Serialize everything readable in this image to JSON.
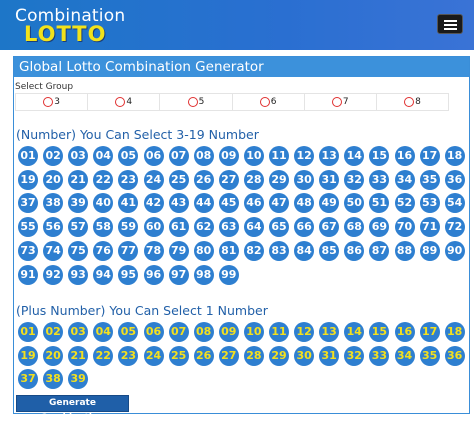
{
  "header": {
    "logo_line1": "Combination",
    "logo_line2": "LOTTO",
    "menu_icon": "hamburger-menu-icon"
  },
  "panel": {
    "title": "Global Lotto Combination Generator",
    "select_group_label": "Select Group",
    "groups": [
      "3",
      "4",
      "5",
      "6",
      "7",
      "8"
    ],
    "number_title": "(Number) You Can Select 3-19 Number",
    "plus_title": "(Plus Number) You Can Select 1 Number",
    "generate_label": "Generate Combination"
  },
  "numbers": [
    "01",
    "02",
    "03",
    "04",
    "05",
    "06",
    "07",
    "08",
    "09",
    "10",
    "11",
    "12",
    "13",
    "14",
    "15",
    "16",
    "17",
    "18",
    "19",
    "20",
    "21",
    "22",
    "23",
    "24",
    "25",
    "26",
    "27",
    "28",
    "29",
    "30",
    "31",
    "32",
    "33",
    "34",
    "35",
    "36",
    "37",
    "38",
    "39",
    "40",
    "41",
    "42",
    "43",
    "44",
    "45",
    "46",
    "47",
    "48",
    "49",
    "50",
    "51",
    "52",
    "53",
    "54",
    "55",
    "56",
    "57",
    "58",
    "59",
    "60",
    "61",
    "62",
    "63",
    "64",
    "65",
    "66",
    "67",
    "68",
    "69",
    "70",
    "71",
    "72",
    "73",
    "74",
    "75",
    "76",
    "77",
    "78",
    "79",
    "80",
    "81",
    "82",
    "83",
    "84",
    "85",
    "86",
    "87",
    "88",
    "89",
    "90",
    "91",
    "92",
    "93",
    "94",
    "95",
    "96",
    "97",
    "98",
    "99"
  ],
  "plus_numbers": [
    "01",
    "02",
    "03",
    "04",
    "05",
    "06",
    "07",
    "08",
    "09",
    "10",
    "11",
    "12",
    "13",
    "14",
    "15",
    "16",
    "17",
    "18",
    "19",
    "20",
    "21",
    "22",
    "23",
    "24",
    "25",
    "26",
    "27",
    "28",
    "29",
    "30",
    "31",
    "32",
    "33",
    "34",
    "35",
    "36",
    "37",
    "38",
    "39"
  ],
  "colors": {
    "header_blue": "#1d76c8",
    "ball_blue": "#2e7fd0",
    "plus_text_yellow": "#f4e01e",
    "logo_yellow": "#f2e21b",
    "section_title_blue": "#2260a8"
  }
}
